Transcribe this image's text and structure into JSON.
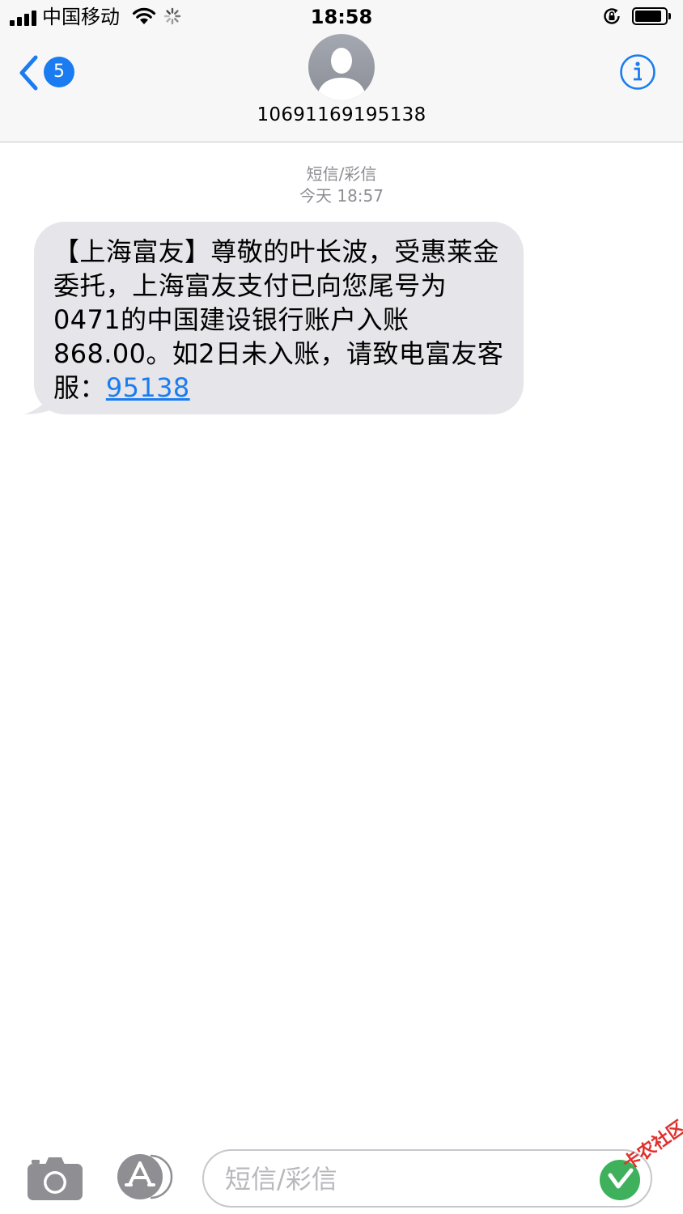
{
  "status_bar": {
    "carrier": "中国移动",
    "time": "18:58"
  },
  "header": {
    "back_badge_count": "5",
    "contact_name": "10691169195138"
  },
  "conversation": {
    "message_type": "短信/彩信",
    "timestamp": "今天 18:57",
    "message": {
      "text": "【上海富友】尊敬的叶长波，受惠莱金委托，上海富友支付已向您尾号为0471的中国建设银行账户入账868.00。如2日未入账，请致电富友客服：",
      "link": "95138"
    }
  },
  "input_bar": {
    "placeholder": "短信/彩信"
  },
  "watermark": {
    "text": "卡农社区"
  },
  "colors": {
    "accent_blue": "#1a7cf0",
    "bubble_gray": "#e5e5ea",
    "secondary_text": "#8e8e93",
    "watermark_red": "#e0302c",
    "watermark_green": "#2aa84a"
  }
}
